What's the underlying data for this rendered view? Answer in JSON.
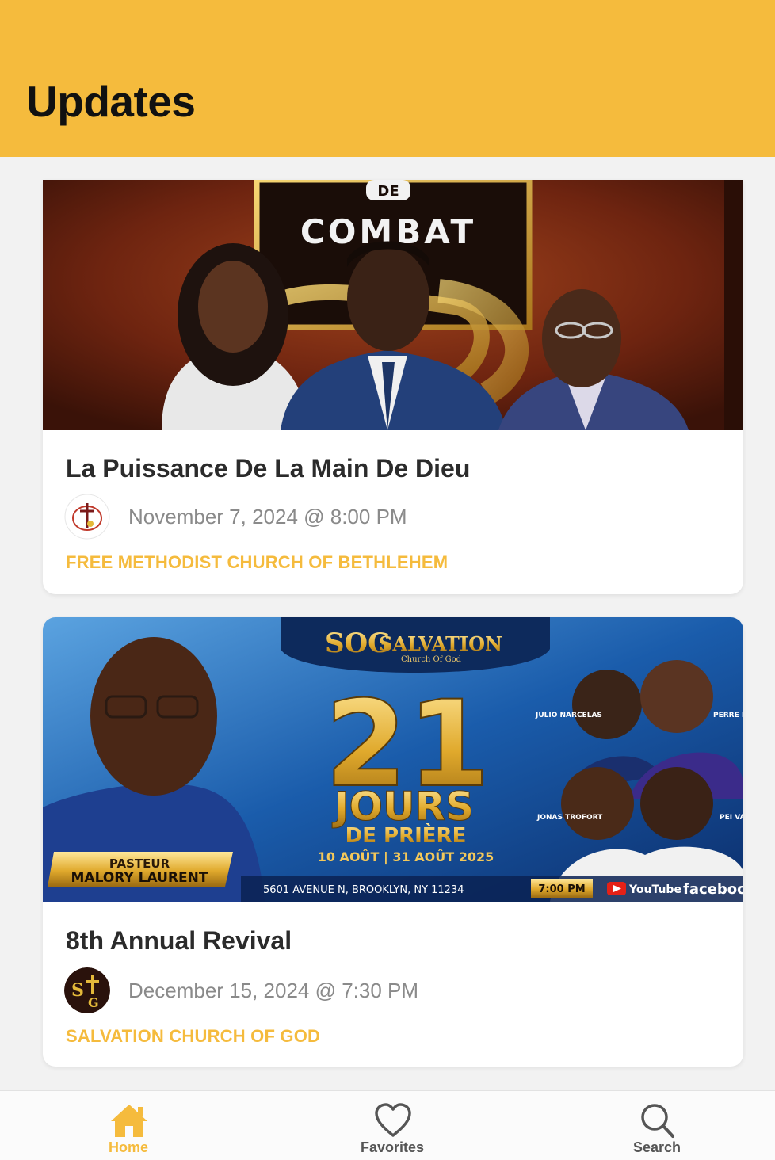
{
  "header": {
    "title": "Updates"
  },
  "posts": [
    {
      "image_text": {
        "small": "DE",
        "big": "COMBAT"
      },
      "title": "La Puissance De La Main De Dieu",
      "date": "November 7, 2024 @ 8:00 PM",
      "organization": "FREE METHODIST CHURCH OF BETHLEHEM"
    },
    {
      "image_text": {
        "brand": "SALVATION",
        "brand_sub": "Church Of God",
        "logo_letters": "SOG",
        "big_number": "21",
        "headline": "JOURS",
        "subheadline": "DE PRIÈRE",
        "dates": "10 AOÛT | 31 AOÛT 2025",
        "pastor_title": "PASTEUR",
        "pastor_name": "MALORY LAURENT",
        "address": "5601 AVENUE N, BROOKLYN, NY 11234",
        "time": "7:00 PM",
        "social_1": "YouTube",
        "social_2": "faceboo",
        "guest_1": "JULIO NARCELAS",
        "guest_2": "PERRE ROCH",
        "guest_3": "JONAS TROFORT",
        "guest_4": "PEI VALL"
      },
      "title": "8th Annual Revival",
      "date": "December 15, 2024 @ 7:30 PM",
      "organization": "SALVATION CHURCH OF GOD"
    }
  ],
  "tabs": [
    {
      "label": "Home",
      "icon": "home-icon",
      "active": true
    },
    {
      "label": "Favorites",
      "icon": "heart-icon",
      "active": false
    },
    {
      "label": "Search",
      "icon": "search-icon",
      "active": false
    }
  ],
  "colors": {
    "accent": "#f5bb3d",
    "title": "#2b2b2b",
    "muted": "#8a8a8a"
  }
}
